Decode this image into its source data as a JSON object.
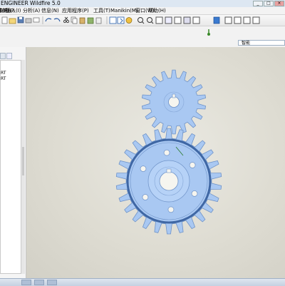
{
  "window": {
    "title": "ENGINEER Wildfire 5.0"
  },
  "menu": {
    "items": [
      "文件(F)",
      "编辑(E)",
      "视图(V)",
      "插入(I)",
      "分析(A)",
      "信息(N)",
      "应用程序(P)",
      "工具(T)",
      "Manikin(M)",
      "窗口(W)",
      "帮助(H)"
    ]
  },
  "toolbar": {
    "filter_label": "智能"
  },
  "model_tree": {
    "items": [
      "RT",
      "RT"
    ]
  },
  "model": {
    "gear_color": "#a9c8f2",
    "gear_edge": "#6f93c8",
    "small_gear": {
      "teeth": 18
    },
    "large_gear": {
      "teeth": 26,
      "holes": 6
    }
  },
  "theme": {
    "accent": "#3c6fb5",
    "viewport_bg": "#dedcd2"
  }
}
